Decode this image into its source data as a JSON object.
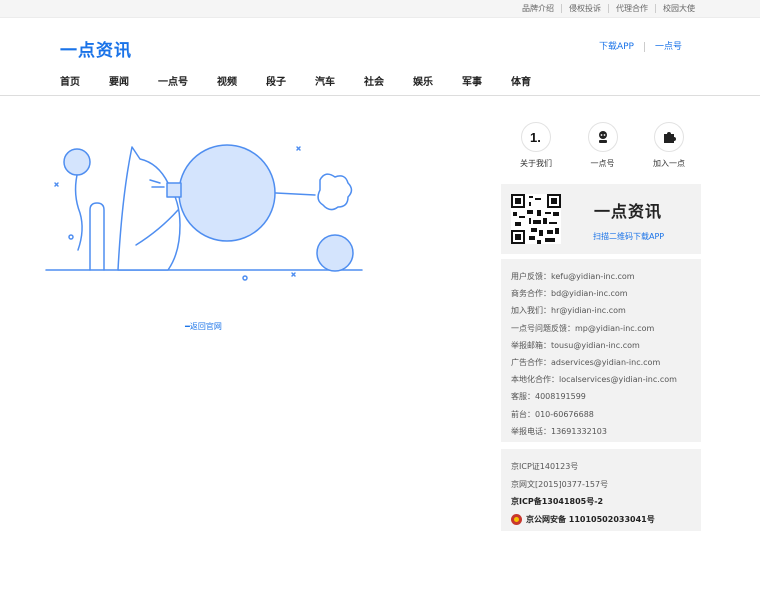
{
  "top_links": [
    "品牌介绍",
    "侵权投诉",
    "代理合作",
    "校园大使"
  ],
  "logo": "一点资讯",
  "header_links": [
    "下载APP",
    "一点号"
  ],
  "nav": [
    "首页",
    "要闻",
    "一点号",
    "视频",
    "段子",
    "汽车",
    "社会",
    "娱乐",
    "军事",
    "体育"
  ],
  "back_link": "━返回官网",
  "sidebar": {
    "icons": [
      {
        "label": "关于我们",
        "icon": "yidian-1-icon"
      },
      {
        "label": "一点号",
        "icon": "robot-icon"
      },
      {
        "label": "加入一点",
        "icon": "puzzle-icon"
      }
    ],
    "qr_logo": "一点资讯",
    "qr_text": "扫描二维码下载APP",
    "contacts": [
      "用户反馈：kefu@yidian-inc.com",
      "商务合作：bd@yidian-inc.com",
      "加入我们：hr@yidian-inc.com",
      "一点号问题反馈：mp@yidian-inc.com",
      "举报邮箱：tousu@yidian-inc.com",
      "广告合作：adservices@yidian-inc.com",
      "本地化合作：localservices@yidian-inc.com",
      "客服：4008191599",
      "前台：010-60676688",
      "举报电话：13691332103"
    ],
    "icp": [
      "京ICP证140123号",
      "京网文[2015]0377-157号",
      "京ICP备13041805号-2"
    ],
    "police": "京公网安备 11010502033041号"
  },
  "colors": {
    "accent": "#1a73e8",
    "illustration": "#4f8ef0",
    "illustration_fill": "#d4e4fd"
  }
}
